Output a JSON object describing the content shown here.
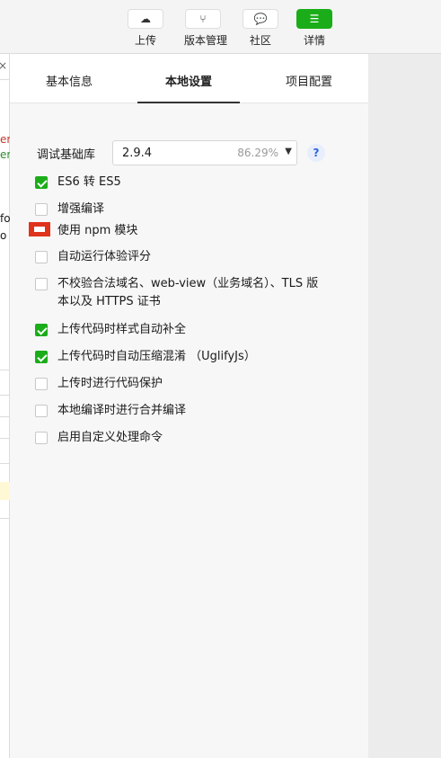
{
  "toolbar": {
    "items": [
      {
        "label": "上传",
        "icon": "cloud-upload-icon",
        "glyph": "☁"
      },
      {
        "label": "版本管理",
        "icon": "branch-icon",
        "glyph": "⑂"
      },
      {
        "label": "社区",
        "icon": "chat-bubble-icon",
        "glyph": "💬"
      },
      {
        "label": "详情",
        "icon": "menu-icon",
        "glyph": "☰"
      }
    ],
    "accent": "#1aad19"
  },
  "gutter": {
    "close": "×",
    "frags": [
      {
        "text": "er",
        "color": "#c0392b"
      },
      {
        "text": "er",
        "color": "#2e8b2e"
      },
      {
        "text": "fo",
        "color": "#222222"
      },
      {
        "text": "o",
        "color": "#222222"
      }
    ]
  },
  "tabs": {
    "basic": "基本信息",
    "local": "本地设置",
    "project": "项目配置"
  },
  "library": {
    "label": "调试基础库",
    "value": "2.9.4",
    "percent": "86.29%",
    "help": "?"
  },
  "options": [
    {
      "label": "ES6 转 ES5",
      "checked": true
    },
    {
      "label": "增强编译",
      "checked": false
    },
    {
      "label": "使用 npm 模块",
      "checked": false,
      "highlight": true
    },
    {
      "label": "自动运行体验评分",
      "checked": false
    },
    {
      "label": "不校验合法域名、web-view（业务域名）、TLS 版",
      "label2": "本以及 HTTPS 证书",
      "checked": false
    },
    {
      "label": "上传代码时样式自动补全",
      "checked": true
    },
    {
      "label": "上传代码时自动压缩混淆 （UglifyJs）",
      "checked": true
    },
    {
      "label": "上传时进行代码保护",
      "checked": false
    },
    {
      "label": "本地编译时进行合并编译",
      "checked": false
    },
    {
      "label": "启用自定义处理命令",
      "checked": false
    }
  ]
}
